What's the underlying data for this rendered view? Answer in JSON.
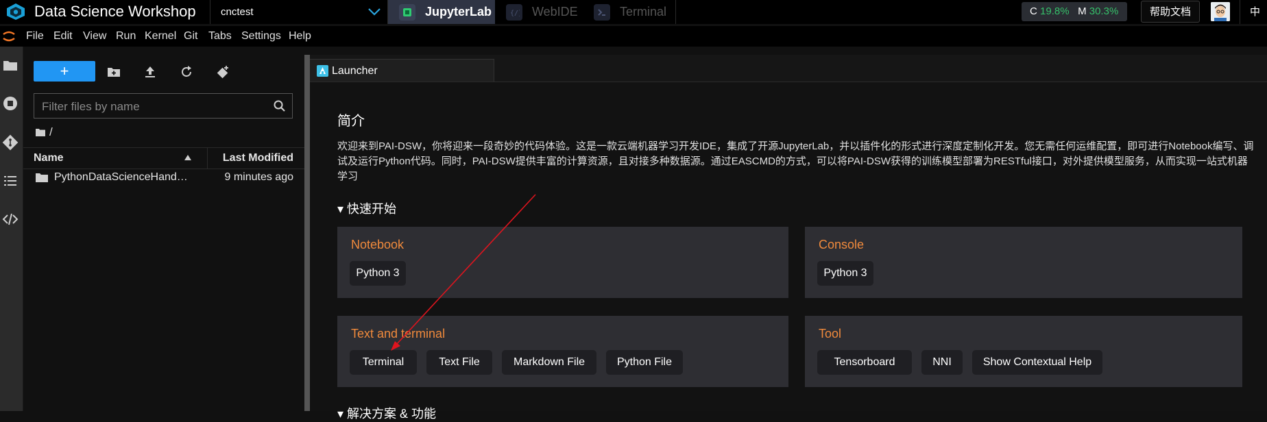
{
  "topbar": {
    "app_title": "Data Science Workshop",
    "workspace": "cnctest",
    "tabs": [
      {
        "label": "JupyterLab",
        "active": true
      },
      {
        "label": "WebIDE",
        "active": false
      },
      {
        "label": "Terminal",
        "active": false
      }
    ],
    "cpu_label": "C",
    "cpu_value": "19.8%",
    "mem_label": "M",
    "mem_value": "30.3%",
    "help_label": "帮助文档",
    "lang_label": "中文"
  },
  "menu": [
    "File",
    "Edit",
    "View",
    "Run",
    "Kernel",
    "Git",
    "Tabs",
    "Settings",
    "Help"
  ],
  "filebrowser": {
    "new_label": "+",
    "filter_placeholder": "Filter files by name",
    "path": "/",
    "col_name": "Name",
    "col_modified": "Last Modified",
    "files": [
      {
        "name": "PythonDataScienceHand…",
        "modified": "9 minutes ago"
      }
    ]
  },
  "main": {
    "tab_label": "Launcher",
    "intro_title": "简介",
    "intro_text": "欢迎来到PAI-DSW，你将迎来一段奇妙的代码体验。这是一款云端机器学习开发IDE，集成了开源JupyterLab，并以插件化的形式进行深度定制化开发。您无需任何运维配置，即可进行Notebook编写、调试及运行Python代码。同时，PAI-DSW提供丰富的计算资源，且对接多种数据源。通过EASCMD的方式，可以将PAI-DSW获得的训练模型部署为RESTful接口，对外提供模型服务，从而实现一站式机器学习",
    "quickstart_label": "▾ 快速开始",
    "section2_label": "▾ 解决方案 & 功能",
    "cards": {
      "notebook": {
        "title": "Notebook",
        "items": [
          "Python 3"
        ]
      },
      "console": {
        "title": "Console",
        "items": [
          "Python 3"
        ]
      },
      "textterm": {
        "title": "Text and terminal",
        "items": [
          "Terminal",
          "Text File",
          "Markdown File",
          "Python File"
        ]
      },
      "tool": {
        "title": "Tool",
        "items": [
          "Tensorboard",
          "NNI",
          "Show Contextual Help"
        ]
      }
    }
  },
  "colors": {
    "accent": "#2196f3",
    "card_title": "#f08a3c",
    "usage_value": "#36c06a",
    "annotation_arrow": "#e0141e"
  }
}
